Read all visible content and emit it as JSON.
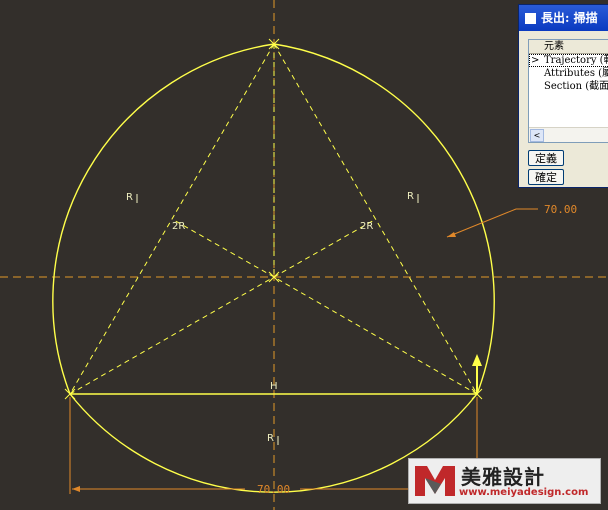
{
  "sketch": {
    "dimension_width": "70.00",
    "dimension_radius": "70.00",
    "radius_label_1": "R",
    "radius_label_2": "R",
    "radius_label_3": "R",
    "angle_label_1": "2R",
    "angle_label_2": "2R",
    "horizontal_constraint": "H"
  },
  "dialog": {
    "title": "長出: 掃描",
    "column_header": "元素",
    "items": [
      {
        "marker": ">",
        "label": "Trajectory (軌"
      },
      {
        "marker": "",
        "label": "Attributes (屬"
      },
      {
        "marker": "",
        "label": "Section (截面"
      }
    ],
    "scroll_left": "<",
    "define_button": "定義",
    "ok_button": "確定"
  },
  "watermark": {
    "brand": "美雅設計",
    "url": "www.meiyadesign.com"
  },
  "colors": {
    "background": "#332f2b",
    "sketch": "#ffff4a",
    "dimension": "#e0882a",
    "titlebar": "#0a3ac0"
  }
}
